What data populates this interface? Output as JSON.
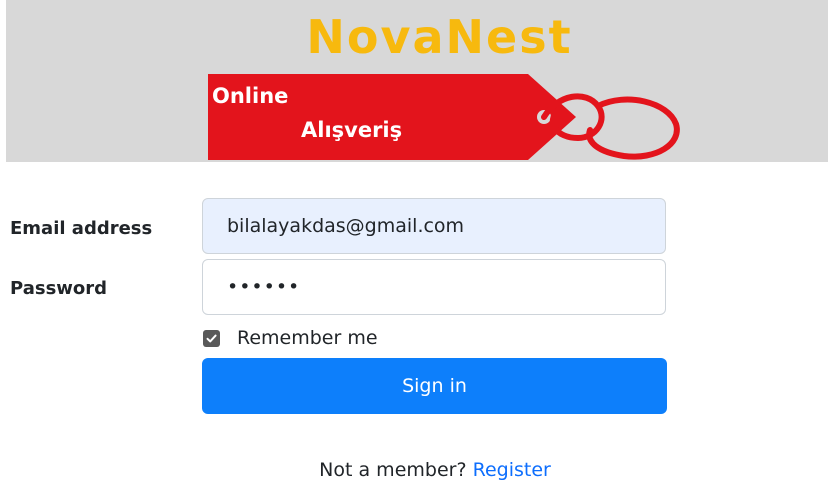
{
  "brand": {
    "name": "NovaNest",
    "tag_line1": "Online",
    "tag_line2": "Alışveriş",
    "colors": {
      "banner_bg": "#d8d8d8",
      "brand_yellow": "#f7b90e",
      "tag_red": "#e3141c"
    }
  },
  "form": {
    "email": {
      "label": "Email address",
      "value": "bilalayakdas@gmail.com"
    },
    "password": {
      "label": "Password",
      "value": "••••••"
    },
    "remember": {
      "label": "Remember me",
      "checked": true
    },
    "submit_label": "Sign in",
    "submit_color": "#0d7ffb"
  },
  "footer": {
    "prompt": "Not a member?",
    "register_label": "Register",
    "link_color": "#0d6efd"
  }
}
